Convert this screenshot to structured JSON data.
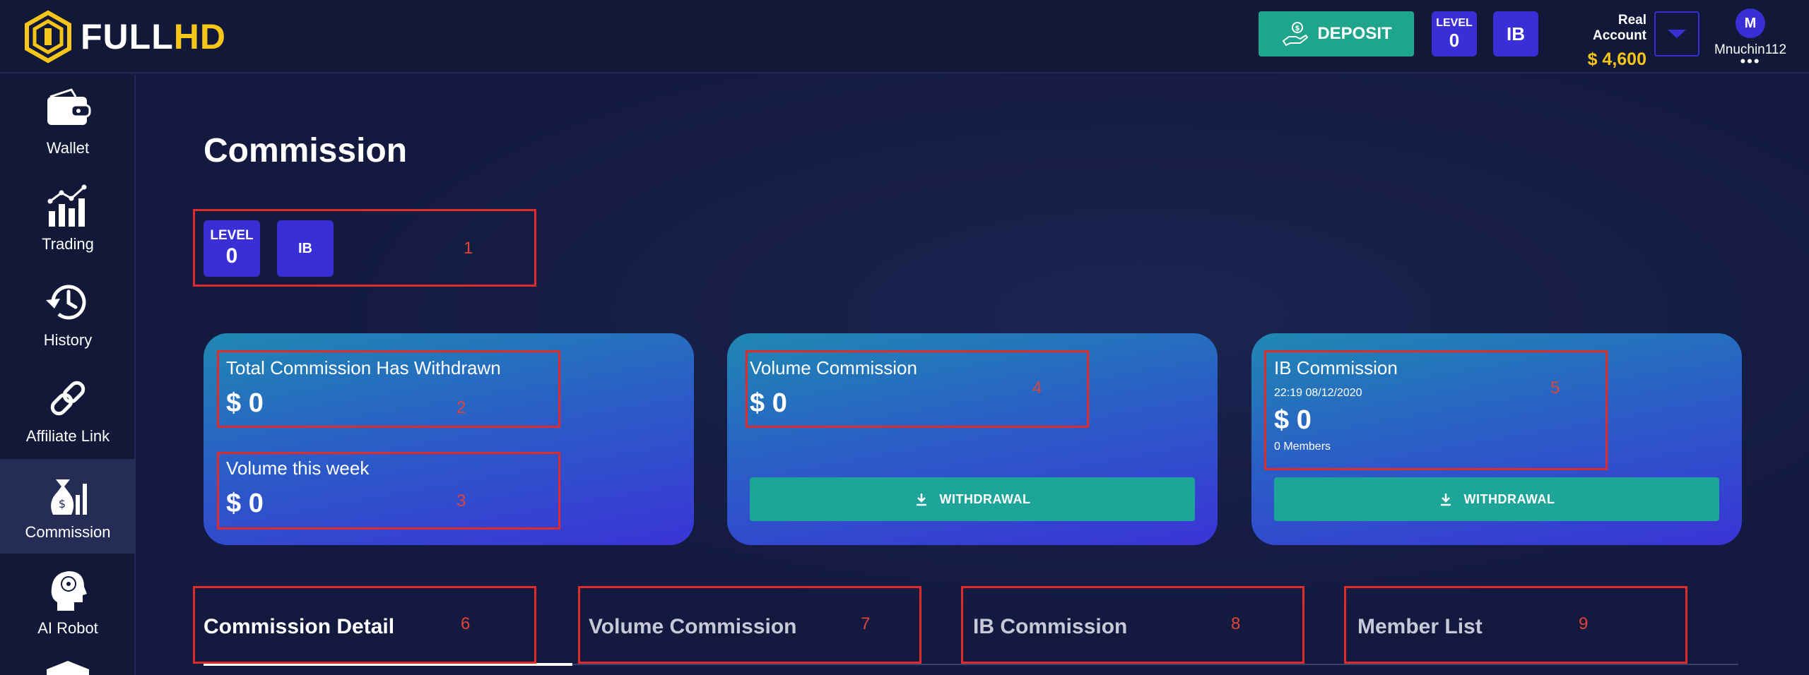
{
  "brand": {
    "logo_white": "FULL",
    "logo_yellow": "HD"
  },
  "header": {
    "deposit_label": "DEPOSIT",
    "level_label": "LEVEL",
    "level_value": "0",
    "ib_label": "IB",
    "account_label": "Real Account",
    "account_balance": "$ 4,600",
    "username": "Mnuchin112",
    "avatar_initial": "M",
    "more_label": "•••"
  },
  "sidebar": {
    "items": [
      {
        "label": "Wallet",
        "icon": "wallet-icon"
      },
      {
        "label": "Trading",
        "icon": "trading-chart-icon"
      },
      {
        "label": "History",
        "icon": "history-icon"
      },
      {
        "label": "Affiliate Link",
        "icon": "link-icon"
      },
      {
        "label": "Commission",
        "icon": "money-bag-icon"
      },
      {
        "label": "AI Robot",
        "icon": "ai-head-icon"
      }
    ]
  },
  "main": {
    "title": "Commission",
    "level_label": "LEVEL",
    "level_value": "0",
    "ib_label": "IB",
    "cards": {
      "total_withdrawn_label": "Total Commission Has Withdrawn",
      "total_withdrawn_value": "$ 0",
      "volume_week_label": "Volume this week",
      "volume_week_value": "$ 0",
      "volume_commission_label": "Volume Commission",
      "volume_commission_value": "$ 0",
      "ib_commission_label": "IB Commission",
      "ib_commission_time": "22:19 08/12/2020",
      "ib_commission_value": "$ 0",
      "ib_members": "0 Members",
      "withdrawal_label": "WITHDRAWAL"
    },
    "tabs": [
      "Commission Detail",
      "Volume Commission",
      "IB Commission",
      "Member List"
    ]
  },
  "annotations": [
    "1",
    "2",
    "3",
    "4",
    "5",
    "6",
    "7",
    "8",
    "9"
  ],
  "colors": {
    "background": "#141a3f",
    "accent_purple": "#3a2fd6",
    "deposit_green": "#1ea58c",
    "gold": "#f5c518",
    "annotation_red": "#e02b2b"
  }
}
